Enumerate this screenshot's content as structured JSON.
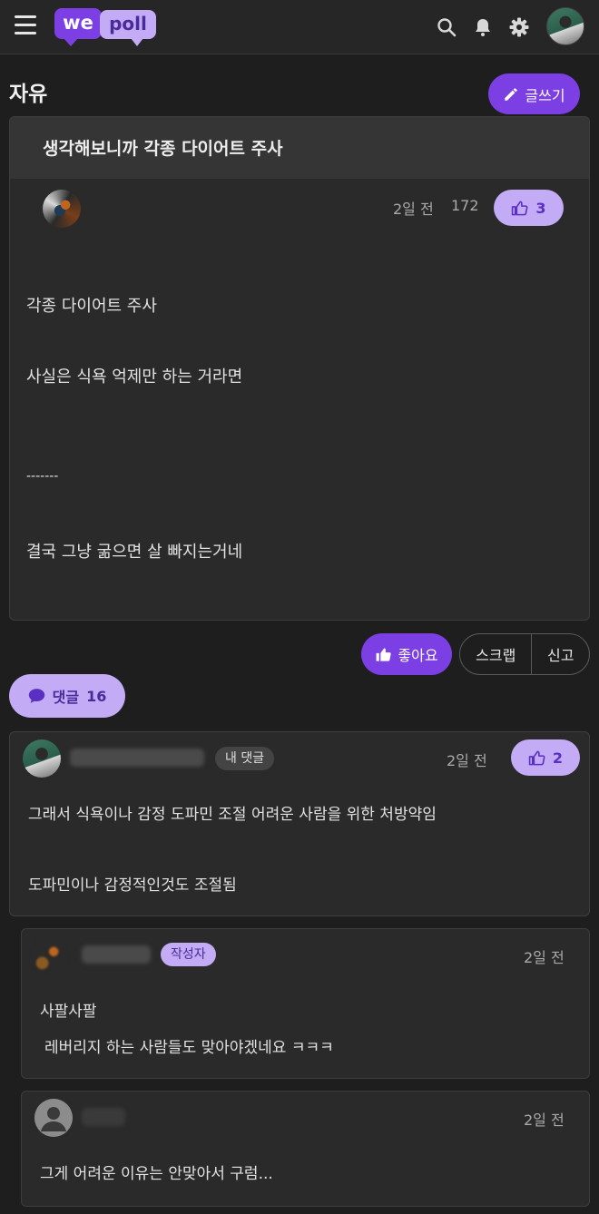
{
  "header": {
    "logo_we": "we",
    "logo_poll": "poll",
    "icons": [
      "menu-icon",
      "search-icon",
      "bell-icon",
      "gear-icon"
    ]
  },
  "board": {
    "title": "자유",
    "write_label": "글쓰기"
  },
  "post": {
    "title": "생각해보니까 각종 다이어트 주사",
    "time": "2일 전",
    "views": "172",
    "likes": "3",
    "body": [
      "각종 다이어트 주사",
      "사실은 식욕 억제만 하는 거라면",
      "-------",
      "결국 그냥 굶으면 살 빠지는거네"
    ]
  },
  "actions": {
    "like_label": "좋아요",
    "scrap_label": "스크랩",
    "report_label": "신고"
  },
  "comments_header": {
    "label": "댓글",
    "count": "16"
  },
  "comments": [
    {
      "tag": "내 댓글",
      "time": "2일 전",
      "likes": "2",
      "lines": [
        "그래서 식욕이나 감정 도파민 조절 어려운 사람을 위한 처방약임",
        "도파민이나 감정적인것도 조절됨"
      ]
    },
    {
      "tag": "작성자",
      "time": "2일 전",
      "lines": [
        "사팔사팔",
        "레버리지 하는 사람들도 맞아야겠네요 ㅋㅋㅋ"
      ]
    },
    {
      "time": "2일 전",
      "lines": [
        "그게 어려운 이유는 안맞아서 구럼..."
      ]
    }
  ],
  "colors": {
    "accent": "#7b3fe4",
    "accent_light": "#c3acf5",
    "background": "#1e1e1e",
    "card": "#2a2a2a"
  }
}
